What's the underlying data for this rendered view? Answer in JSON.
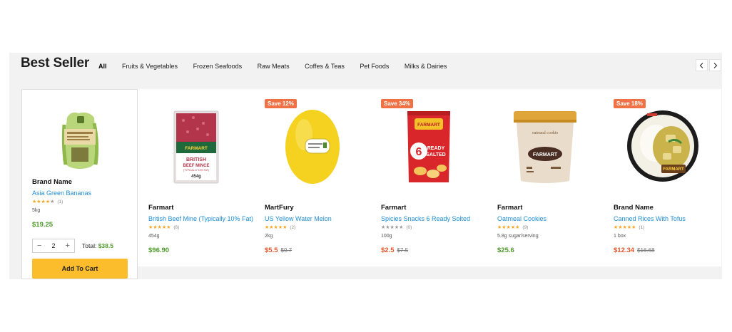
{
  "section": {
    "title": "Best Seller",
    "tabs": [
      "All",
      "Fruits & Vegetables",
      "Frozen Seafoods",
      "Raw Meats",
      "Coffes & Teas",
      "Pet Foods",
      "Milks & Dairies"
    ],
    "active_tab": "All",
    "nav": {
      "prev_icon": "chevron-left-icon",
      "next_icon": "chevron-right-icon"
    }
  },
  "featured": {
    "brand": "Brand Name",
    "name": "Asia Green Bananas",
    "rating": 4,
    "rating_count": "(1)",
    "unit": "5kg",
    "price": "$19.25",
    "quantity": "2",
    "qty_minus": "−",
    "qty_plus": "+",
    "total_label": "Total:",
    "total_value": "$38.5",
    "add_to_cart": "Add To Cart"
  },
  "products": [
    {
      "brand": "Farmart",
      "name": "British Beef Mine (Typically 10% Fat)",
      "rating": 5,
      "rating_count": "(6)",
      "unit": "454g",
      "price": "$96.90",
      "old_price": "",
      "badge": "",
      "sale": false
    },
    {
      "brand": "MartFury",
      "name": "US Yellow Water Melon",
      "rating": 5,
      "rating_count": "(2)",
      "unit": "2kg",
      "price": "$5.5",
      "old_price": "$9.7",
      "badge": "Save 12%",
      "sale": true
    },
    {
      "brand": "Farmart",
      "name": "Spicies Snacks 6 Ready Solted",
      "rating": 0,
      "rating_count": "(0)",
      "unit": "100g",
      "price": "$2.5",
      "old_price": "$7.5",
      "badge": "Save 34%",
      "sale": true
    },
    {
      "brand": "Farmart",
      "name": "Oatmeal Cookies",
      "rating": 5,
      "rating_count": "(9)",
      "unit": "5.8g sugar/serving",
      "price": "$25.6",
      "old_price": "",
      "badge": "",
      "sale": false
    },
    {
      "brand": "Brand Name",
      "name": "Canned Rices With Tofus",
      "rating": 5,
      "rating_count": "(1)",
      "unit": "1 box",
      "price": "$12.34",
      "old_price": "$16.68",
      "badge": "Save 18%",
      "sale": true
    }
  ],
  "image_text": {
    "beef_label": "FARMART",
    "beef_line1": "BRITISH",
    "beef_line2": "BEEF MINCE",
    "beef_line3": "(TYPICALLY 10% FAT)",
    "beef_weight": "454g",
    "chips_brand": "FARMART",
    "chips_num": "6",
    "chips_line1": "READY",
    "chips_line2": "SALTED",
    "cookie_top": "oatmeal cookie",
    "cookie_brand": "FARMART",
    "tofu_brand": "FARMART"
  },
  "colors": {
    "accent": "#fbbd2c",
    "sale": "#e8542a",
    "badge": "#f07144",
    "price": "#4d9b2b",
    "link": "#1e8fd6",
    "star": "#f5a623"
  }
}
